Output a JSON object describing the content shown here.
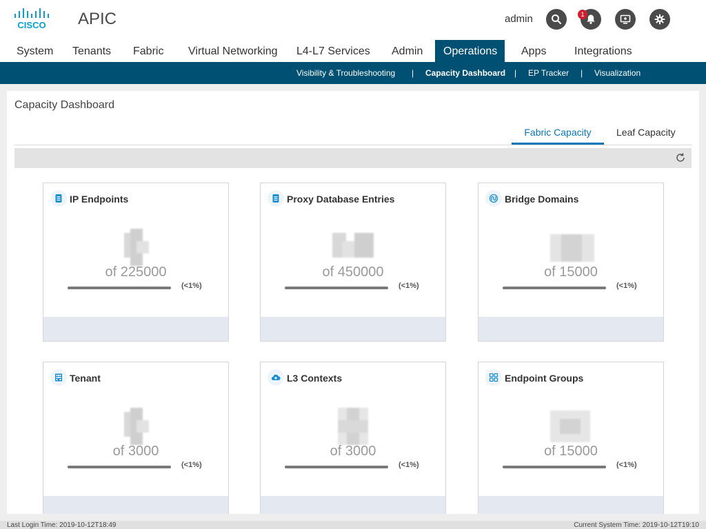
{
  "header": {
    "logo_text": "CISCO",
    "app_title": "APIC",
    "user": "admin",
    "notification_count": "1",
    "brand_color": "#005073",
    "accent_color": "#0b76b8"
  },
  "main_nav": {
    "items": [
      "System",
      "Tenants",
      "Fabric",
      "Virtual Networking",
      "L4-L7 Services",
      "Admin",
      "Operations",
      "Apps",
      "Integrations"
    ],
    "active": "Operations"
  },
  "sub_nav": {
    "items": [
      "Visibility & Troubleshooting",
      "Capacity Dashboard",
      "EP Tracker",
      "Visualization"
    ],
    "active": "Capacity Dashboard"
  },
  "page": {
    "title": "Capacity Dashboard",
    "tabs": [
      "Fabric Capacity",
      "Leaf Capacity"
    ],
    "active_tab": "Fabric Capacity"
  },
  "cards": [
    {
      "title": "IP Endpoints",
      "icon": "document-icon",
      "capacity": "of 225000",
      "percent": "(<1%)",
      "usage_fraction": 0.005
    },
    {
      "title": "Proxy Database Entries",
      "icon": "document-icon",
      "capacity": "of 450000",
      "percent": "(<1%)",
      "usage_fraction": 0.005
    },
    {
      "title": "Bridge Domains",
      "icon": "bridge-icon",
      "capacity": "of 15000",
      "percent": "(<1%)",
      "usage_fraction": 0.005
    },
    {
      "title": "Tenant",
      "icon": "building-icon",
      "capacity": "of 3000",
      "percent": "(<1%)",
      "usage_fraction": 0.005
    },
    {
      "title": "L3 Contexts",
      "icon": "cloud-upload-icon",
      "capacity": "of 3000",
      "percent": "(<1%)",
      "usage_fraction": 0.005
    },
    {
      "title": "Endpoint Groups",
      "icon": "endpoint-groups-icon",
      "capacity": "of 15000",
      "percent": "(<1%)",
      "usage_fraction": 0.005
    }
  ],
  "status_bar": {
    "last_login": "Last Login Time: 2019-10-12T18:49",
    "system_time": "Current System Time: 2019-10-12T19:10"
  }
}
